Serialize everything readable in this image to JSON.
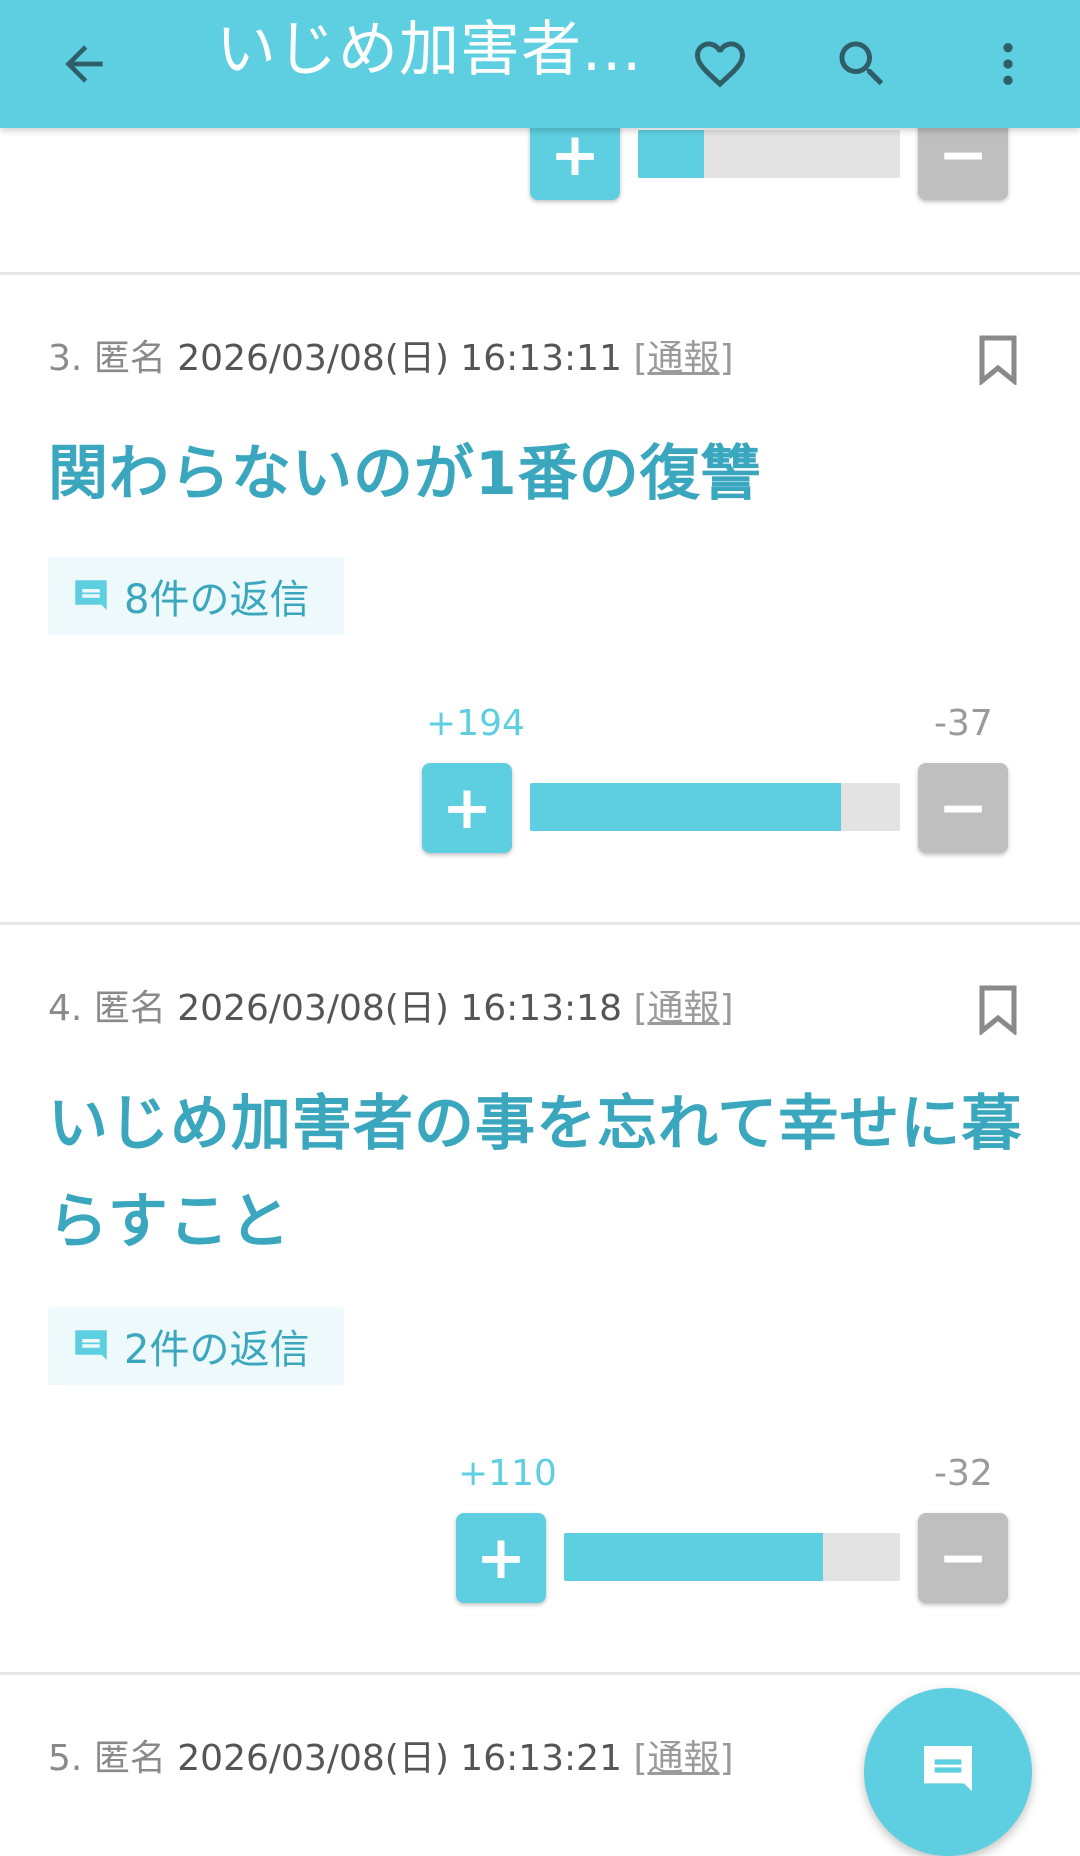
{
  "appbar": {
    "title": "いじめ加害者...",
    "icons": [
      "back-arrow-icon",
      "heart-icon",
      "search-icon",
      "more-vertical-icon"
    ]
  },
  "colors": {
    "accent": "#5ecfe0",
    "text_accent": "#3aa7be",
    "minus": "#bfbfbf"
  },
  "top_partial": {
    "plus_symbol": "+",
    "minus_symbol": "−",
    "plus_ratio": 0.25
  },
  "posts": [
    {
      "num": "3.",
      "author": "匿名",
      "datetime": "2026/03/08(日) 16:13:11",
      "report": "[通報]",
      "body": "関わらないのが1番の復讐",
      "replies": "8件の返信",
      "plus": "+194",
      "minus": "-37",
      "plus_ratio": 0.84
    },
    {
      "num": "4.",
      "author": "匿名",
      "datetime": "2026/03/08(日) 16:13:18",
      "report": "[通報]",
      "body": "いじめ加害者の事を忘れて幸せに暮らすこと",
      "replies": "2件の返信",
      "plus": "+110",
      "minus": "-32",
      "plus_ratio": 0.77
    },
    {
      "num": "5.",
      "author": "匿名",
      "datetime": "2026/03/08(日) 16:13:21",
      "report": "[通報]"
    }
  ],
  "vote_symbols": {
    "plus": "+",
    "minus": "−"
  }
}
